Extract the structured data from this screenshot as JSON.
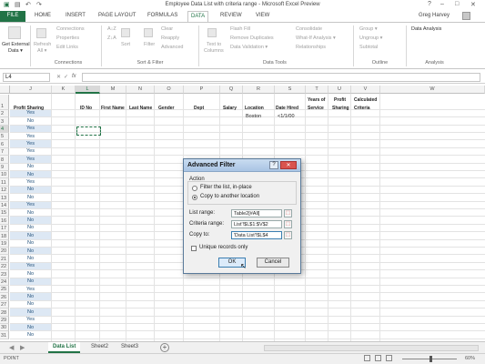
{
  "window": {
    "title": "Employee Data List with criteria range - Microsoft Excel Preview",
    "user": "Greg Harvey",
    "help": "?",
    "min": "–",
    "max": "□",
    "close": "✕"
  },
  "ribbon_tabs": [
    "FILE",
    "HOME",
    "INSERT",
    "PAGE LAYOUT",
    "FORMULAS",
    "DATA",
    "REVIEW",
    "VIEW"
  ],
  "ribbon": {
    "external": "Get External",
    "external2": "Data ▾",
    "refresh": "Refresh",
    "refresh2": "All ▾",
    "connections": "Connections",
    "properties": "Properties",
    "edit_links": "Edit Links",
    "sort": "Sort",
    "filter": "Filter",
    "clear": "Clear",
    "reapply": "Reapply",
    "advanced": "Advanced",
    "text_to": "Text to",
    "columns": "Columns",
    "flash_fill": "Flash Fill",
    "remove_dup": "Remove Duplicates",
    "data_validation": "Data Validation ▾",
    "consolidate": "Consolidate",
    "what_if": "What-If Analysis ▾",
    "relationships": "Relationships",
    "group": "Group ▾",
    "ungroup": "Ungroup ▾",
    "subtotal": "Subtotal",
    "data_analysis": "Data Analysis",
    "groups": {
      "connections": "Connections",
      "sort_filter": "Sort & Filter",
      "data_tools": "Data Tools",
      "outline": "Outline",
      "analysis": "Analysis"
    }
  },
  "formula_bar": {
    "name_box": "L4",
    "fx": "fx",
    "x": "✕",
    "check": "✓"
  },
  "columns": [
    "J",
    "K",
    "L",
    "M",
    "N",
    "O",
    "P",
    "Q",
    "R",
    "S",
    "T",
    "U",
    "V",
    "W"
  ],
  "headers": {
    "profit_sharing": "Profit Sharing",
    "id_no": "ID No",
    "first_name": "First Name",
    "last_name": "Last Name",
    "gender": "Gender",
    "dept": "Dept",
    "salary": "Salary",
    "location": "Location",
    "date_hired": "Date Hired",
    "years_of": "Years of",
    "service": "Service",
    "profit": "Profit",
    "sharing": "Sharing",
    "calculated": "Calculated",
    "criteria": "Criteria"
  },
  "criteria_row": {
    "location": "Boston",
    "date_hired": "<1/1/00"
  },
  "rows": [
    "1",
    "2",
    "3",
    "4",
    "5",
    "6",
    "7",
    "8",
    "9",
    "10",
    "11",
    "12",
    "13",
    "14",
    "15",
    "16",
    "17",
    "18",
    "19",
    "20",
    "21",
    "22",
    "23",
    "24",
    "25",
    "26",
    "27",
    "28",
    "29",
    "30",
    "31"
  ],
  "profit_sharing_values": [
    "Yes",
    "No",
    "Yes",
    "Yes",
    "Yes",
    "Yes",
    "Yes",
    "No",
    "No",
    "Yes",
    "No",
    "No",
    "Yes",
    "No",
    "No",
    "No",
    "No",
    "No",
    "No",
    "No",
    "Yes",
    "No",
    "No",
    "Yes",
    "No",
    "No",
    "No",
    "Yes",
    "No",
    "No"
  ],
  "sheet_tabs": [
    "Data List",
    "Sheet2",
    "Sheet3"
  ],
  "status": {
    "mode": "POINT",
    "zoom": "60%"
  },
  "dialog": {
    "title": "Advanced Filter",
    "help": "?",
    "close": "✕",
    "action_label": "Action",
    "option_filter": "Filter the list, in-place",
    "option_copy": "Copy to another location",
    "list_range_label": "List range:",
    "list_range_value": "Table2[#All]",
    "criteria_range_label": "Criteria range:",
    "criteria_range_value": "List'!$L$1:$V$2",
    "copy_to_label": "Copy to:",
    "copy_to_value": "'Data List'!$L$4",
    "unique_label": "Unique records only",
    "ok": "OK",
    "cancel": "Cancel"
  },
  "colors": {
    "accent": "#217346",
    "band": "#dde8f4"
  }
}
